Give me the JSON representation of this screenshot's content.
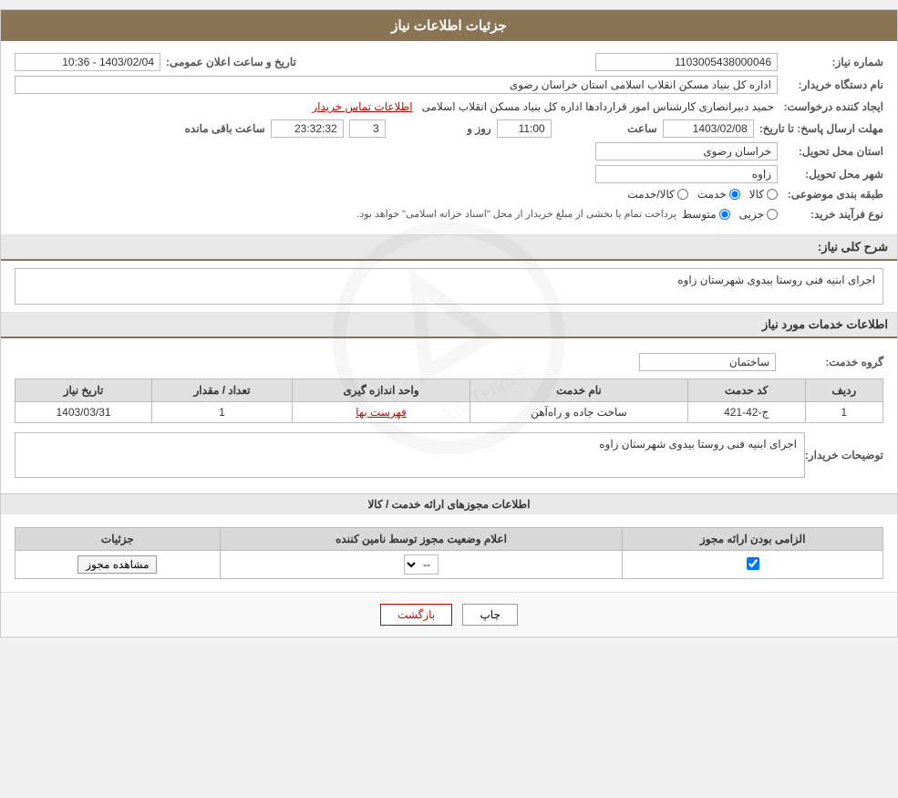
{
  "page": {
    "title": "جزئیات اطلاعات نیاز"
  },
  "header": {
    "announcement_label": "تاریخ و ساعت اعلان عمومی:",
    "announcement_value": "1403/02/04 - 10:36",
    "need_number_label": "شماره نیاز:",
    "need_number_value": "1103005438000046",
    "org_name_label": "نام دستگاه خریدار:",
    "org_name_value": "اداره کل بنیاد مسکن انقلاب اسلامی استان خراسان رضوی",
    "creator_label": "ایجاد کننده درخواست:",
    "creator_name": "حمید دبیرانصاری کارشناس امور قراردادها اداره کل بنیاد مسکن انقلاب اسلامی",
    "creator_contact": "اطلاعات تماس خریدار",
    "deadline_label": "مهلت ارسال پاسخ: تا تاریخ:",
    "deadline_date": "1403/02/08",
    "deadline_time_label": "ساعت",
    "deadline_time": "11:00",
    "deadline_days_label": "روز و",
    "deadline_days": "3",
    "deadline_remaining_label": "ساعت باقی مانده",
    "deadline_remaining": "23:32:32",
    "province_label": "استان محل تحویل:",
    "province_value": "خراسان رضوی",
    "city_label": "شهر محل تحویل:",
    "city_value": "زاوه",
    "category_label": "طبقه بندی موضوعی:",
    "category_options": [
      "کالا",
      "خدمت",
      "کالا/خدمت"
    ],
    "category_selected": "خدمت",
    "procurement_label": "نوع فرآیند خرید:",
    "procurement_options": [
      "جزیی",
      "متوسط"
    ],
    "procurement_note": "پرداخت تمام یا بخشی از مبلغ خریدار از محل \"اسناد خزانه اسلامی\" خواهد بود."
  },
  "need_description": {
    "section_title": "شرح کلی نیاز:",
    "content": "اجرای ابنیه فنی روستا بیدوی شهرستان زاوه"
  },
  "services": {
    "section_title": "اطلاعات خدمات مورد نیاز",
    "group_label": "گروه خدمت:",
    "group_value": "ساختمان",
    "table": {
      "columns": [
        "ردیف",
        "کد حدمت",
        "نام خدمت",
        "واحد اندازه گیری",
        "تعداد / مقدار",
        "تاریخ نیاز"
      ],
      "rows": [
        {
          "row": "1",
          "code": "ج-42-421",
          "name": "ساخت جاده و راه‌آهن",
          "unit": "فهرست بها",
          "quantity": "1",
          "date": "1403/03/31"
        }
      ]
    }
  },
  "buyer_notes": {
    "label": "توضیحات خریدار:",
    "content": "اجرای ابنیه فنی روستا بیدوی شهرستان زاوه"
  },
  "permissions": {
    "section_title": "اطلاعات مجوزهای ارائه خدمت / کالا",
    "table": {
      "columns": [
        "الزامی بودن ارائه مجوز",
        "اعلام وضعیت مجوز توسط نامین کننده",
        "جزئیات"
      ],
      "rows": [
        {
          "required": true,
          "status_options": [
            "--"
          ],
          "status_selected": "--",
          "details_label": "مشاهده مجوز"
        }
      ]
    }
  },
  "footer": {
    "print_label": "چاپ",
    "back_label": "بازگشت"
  }
}
